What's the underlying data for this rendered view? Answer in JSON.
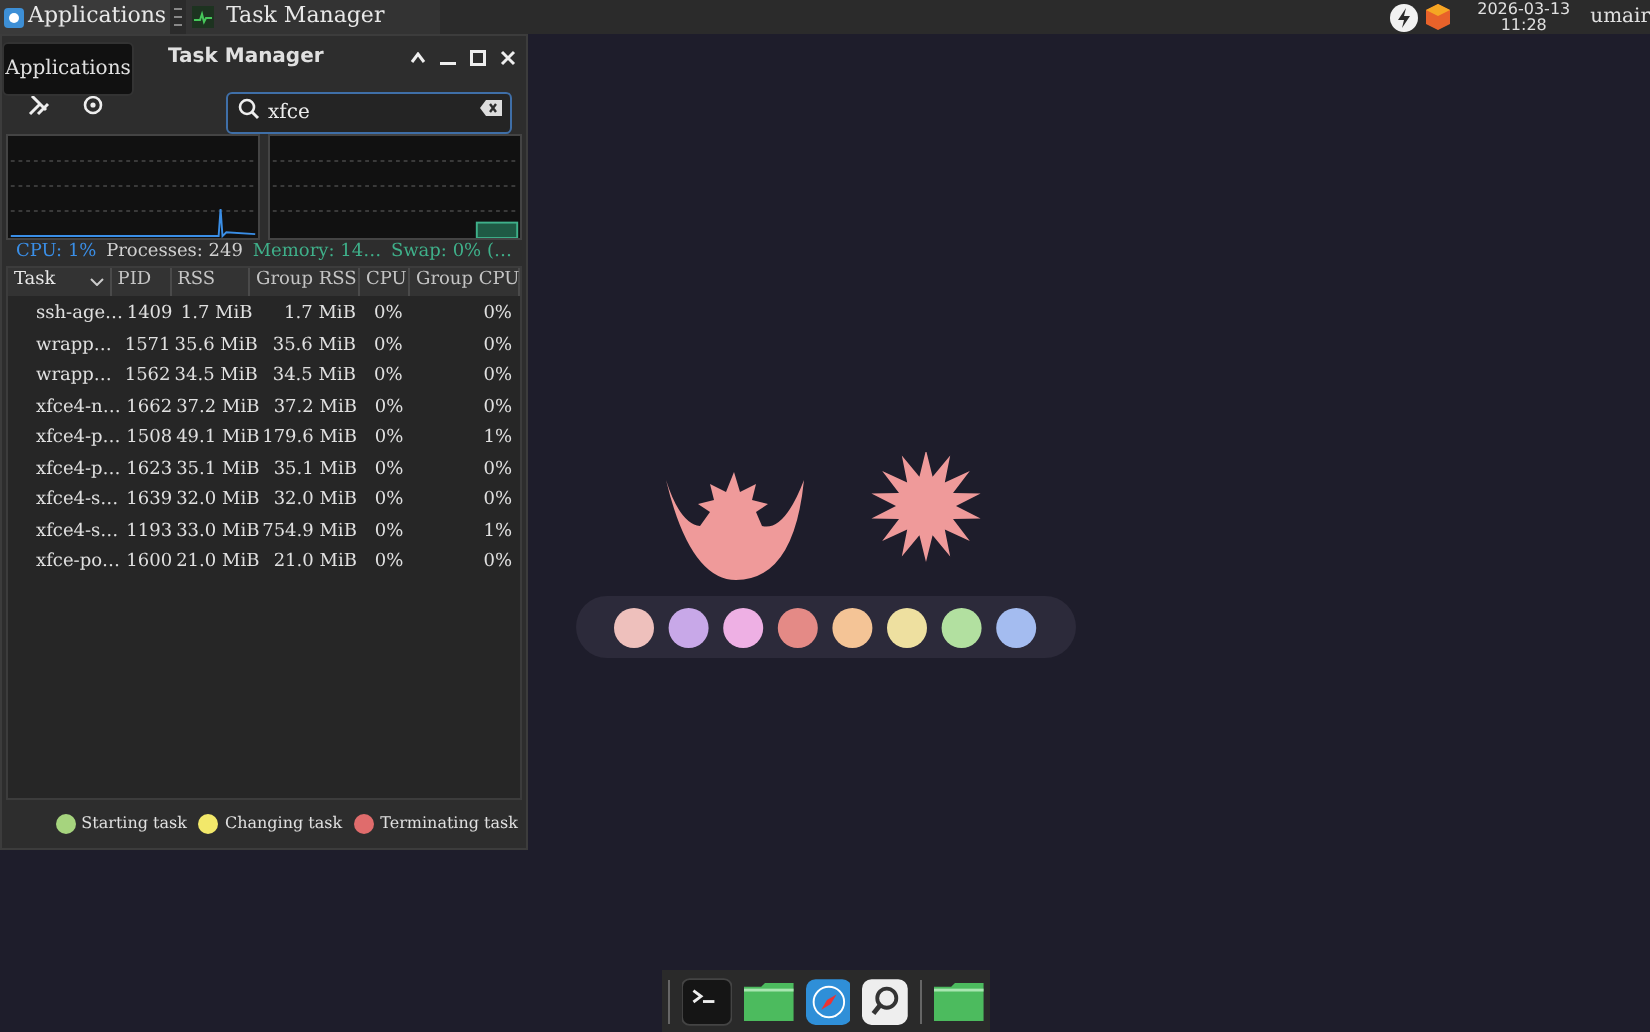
{
  "top_panel": {
    "apps_button": "Applications",
    "task_button": "Task Manager",
    "clock_date": "2026-03-13",
    "clock_time": "11:28",
    "user": "umair"
  },
  "tooltip": "Applications",
  "window": {
    "title": "Task Manager",
    "search": {
      "value": "xfce"
    },
    "stats": [
      {
        "text": "CPU: 1%",
        "color": "#3a8ee6"
      },
      {
        "text": "Processes: 249",
        "color": "#d0d0d0"
      },
      {
        "text": "Memory: 14…",
        "color": "#3fb08a"
      },
      {
        "text": "Swap: 0% (…",
        "color": "#3fb08a"
      }
    ],
    "table": {
      "columns": [
        {
          "label": "Task",
          "sorted": true
        },
        {
          "label": "PID",
          "sorted": false
        },
        {
          "label": "RSS",
          "sorted": false
        },
        {
          "label": "Group RSS",
          "sorted": false
        },
        {
          "label": "CPU",
          "sorted": false
        },
        {
          "label": "Group CPU",
          "sorted": false
        }
      ],
      "rows": [
        [
          "ssh-age…",
          "1409",
          "1.7 MiB",
          "1.7 MiB",
          "0%",
          "0%"
        ],
        [
          "wrapp…",
          "1571",
          "35.6 MiB",
          "35.6 MiB",
          "0%",
          "0%"
        ],
        [
          "wrapp…",
          "1562",
          "34.5 MiB",
          "34.5 MiB",
          "0%",
          "0%"
        ],
        [
          "xfce4-n…",
          "1662",
          "37.2 MiB",
          "37.2 MiB",
          "0%",
          "0%"
        ],
        [
          "xfce4-p…",
          "1508",
          "49.1 MiB",
          "179.6 MiB",
          "0%",
          "1%"
        ],
        [
          "xfce4-p…",
          "1623",
          "35.1 MiB",
          "35.1 MiB",
          "0%",
          "0%"
        ],
        [
          "xfce4-s…",
          "1639",
          "32.0 MiB",
          "32.0 MiB",
          "0%",
          "0%"
        ],
        [
          "xfce4-s…",
          "1193",
          "33.0 MiB",
          "754.9 MiB",
          "0%",
          "1%"
        ],
        [
          "xfce-po…",
          "1600",
          "21.0 MiB",
          "21.0 MiB",
          "0%",
          "0%"
        ]
      ]
    },
    "legend": [
      {
        "label": "Starting task",
        "color": "#a6d47e"
      },
      {
        "label": "Changing task",
        "color": "#f2e86a"
      },
      {
        "label": "Terminating task",
        "color": "#e06c6c"
      }
    ]
  }
}
